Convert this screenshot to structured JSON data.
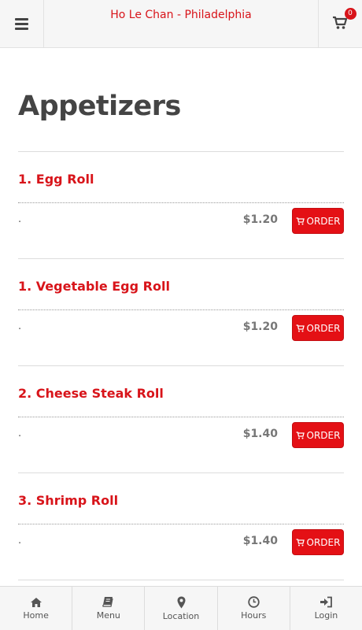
{
  "header": {
    "title": "Ho Le Chan - Philadelphia",
    "menu_icon": "hamburger-icon",
    "cart_icon": "shopping-cart-icon",
    "cart_count": "0"
  },
  "page": {
    "title": "Appetizers"
  },
  "items": [
    {
      "name": "1. Egg Roll",
      "description": ".",
      "price": "$1.20",
      "order_label": "ORDER"
    },
    {
      "name": "1. Vegetable Egg Roll",
      "description": ".",
      "price": "$1.20",
      "order_label": "ORDER"
    },
    {
      "name": "2. Cheese Steak Roll",
      "description": ".",
      "price": "$1.40",
      "order_label": "ORDER"
    },
    {
      "name": "3. Shrimp Roll",
      "description": ".",
      "price": "$1.40",
      "order_label": "ORDER"
    }
  ],
  "bottom_nav": [
    {
      "label": "Home",
      "icon": "home-icon"
    },
    {
      "label": "Menu",
      "icon": "book-icon"
    },
    {
      "label": "Location",
      "icon": "map-marker-icon"
    },
    {
      "label": "Hours",
      "icon": "clock-icon"
    },
    {
      "label": "Login",
      "icon": "sign-in-icon"
    }
  ],
  "colors": {
    "accent": "#d8141a",
    "order_button": "#e41015",
    "text": "#444444"
  }
}
